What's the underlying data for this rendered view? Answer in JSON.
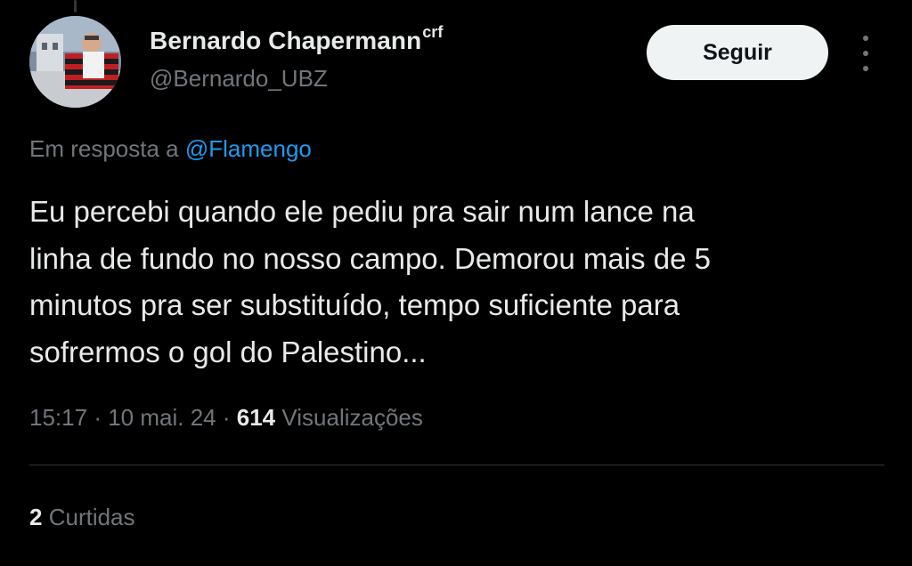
{
  "tweet": {
    "author": {
      "display_name": "Bernardo Chapermann",
      "name_suffix": "crf",
      "handle": "@Bernardo_UBZ"
    },
    "follow_label": "Seguir",
    "reply_prefix": "Em resposta a",
    "reply_mention": "@Flamengo",
    "text": "Eu percebi quando ele pediu pra sair num lance na\nlinha de fundo no nosso campo. Demorou mais de 5\nminutos pra ser substituído, tempo suficiente para\nsofrermos o gol do Palestino...",
    "time": "15:17",
    "separator": "·",
    "date": "10 mai. 24",
    "views_count": "614",
    "views_label": "Visualizações",
    "likes_count": "2",
    "likes_label": "Curtidas"
  },
  "colors": {
    "background": "#000000",
    "primary_text": "#e7e9ea",
    "secondary_text": "#71767b",
    "link": "#1d9bf0",
    "button_bg": "#eff3f4",
    "divider": "#2f3336"
  },
  "icons": {
    "more": "more-vertical-icon"
  }
}
